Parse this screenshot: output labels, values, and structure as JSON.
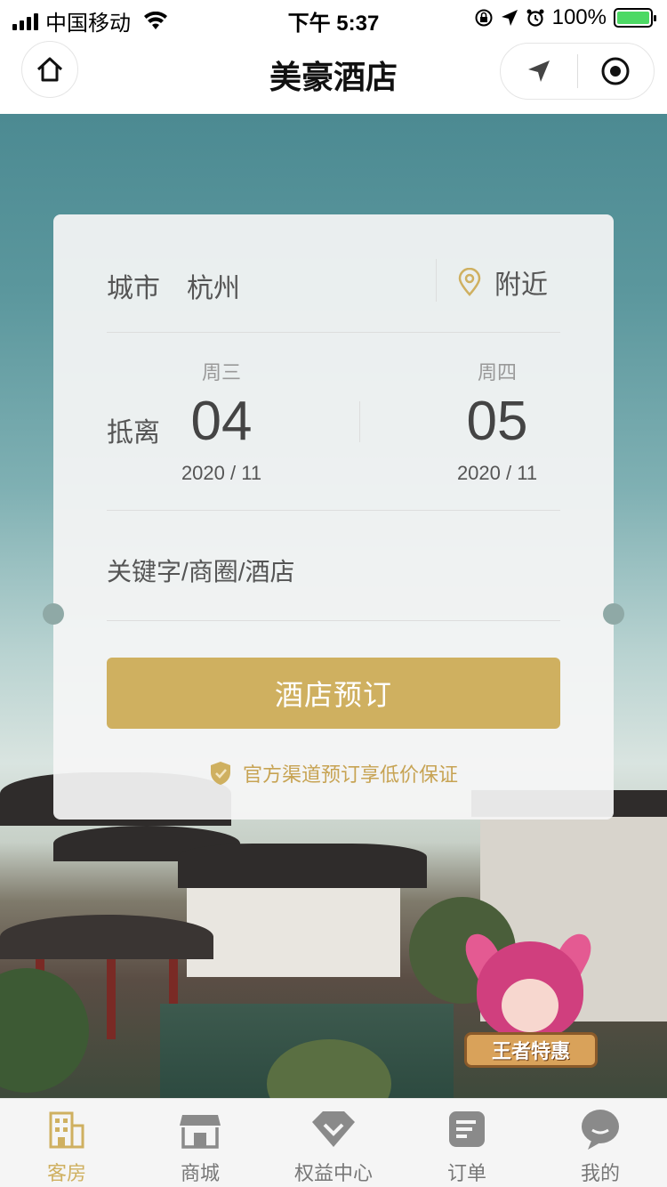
{
  "status_bar": {
    "carrier": "中国移动",
    "time": "下午 5:37",
    "battery": "100%"
  },
  "nav": {
    "title": "美豪酒店"
  },
  "search_card": {
    "city_label": "城市",
    "city_value": "杭州",
    "nearby_label": "附近",
    "dates_label": "抵离",
    "checkin": {
      "weekday": "周三",
      "day": "04",
      "year_month": "2020 / 11"
    },
    "checkout": {
      "weekday": "周四",
      "day": "05",
      "year_month": "2020 / 11"
    },
    "keyword_placeholder": "关键字/商圈/酒店",
    "book_button": "酒店预订",
    "guarantee_text": "官方渠道预订享低价保证"
  },
  "promo": {
    "label": "王者特惠"
  },
  "tab_bar": {
    "items": [
      {
        "label": "客房",
        "icon": "building-icon",
        "active": true
      },
      {
        "label": "商城",
        "icon": "store-icon",
        "active": false
      },
      {
        "label": "权益中心",
        "icon": "diamond-icon",
        "active": false
      },
      {
        "label": "订单",
        "icon": "order-icon",
        "active": false
      },
      {
        "label": "我的",
        "icon": "chat-bubble-icon",
        "active": false
      }
    ]
  },
  "colors": {
    "accent_gold": "#cfb060",
    "tab_inactive": "#777777"
  }
}
